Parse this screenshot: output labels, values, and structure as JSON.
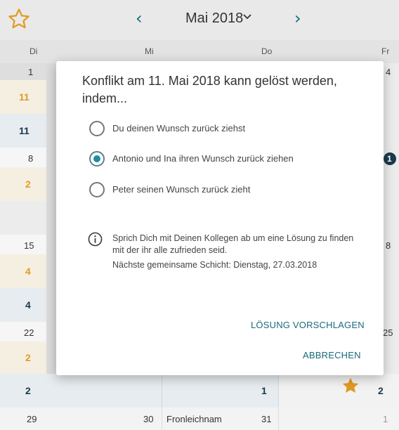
{
  "header": {
    "month": "Mai 2018",
    "prev_arrow": "‹",
    "next_arrow": "›"
  },
  "weekdays": [
    "Di",
    "Mi",
    "Do",
    "Fr"
  ],
  "calendar": {
    "week1": {
      "di_day": "1",
      "fr_day": "4",
      "count_a": "11",
      "count_b": "11"
    },
    "week2": {
      "di_day": "8",
      "count_a": "2",
      "fr_badge": "1"
    },
    "week3": {
      "di_day": "15",
      "fr_day": "8",
      "count_a": "4",
      "count_b": "4"
    },
    "week4": {
      "di_day": "22",
      "fr_day": "25",
      "count_a": "2",
      "count_b": "2",
      "do_count": "1",
      "fr_count": "2"
    },
    "week5": {
      "di_day": "29",
      "mi_day": "30",
      "do_label": "Fronleichnam",
      "do_day": "31",
      "fr_day": "1"
    }
  },
  "dialog": {
    "title": "Konflikt am 11. Mai 2018 kann gelöst werden, indem...",
    "options": [
      {
        "label": "Du deinen Wunsch zurück ziehst",
        "selected": false
      },
      {
        "label": "Antonio und Ina ihren Wunsch zurück ziehen",
        "selected": true
      },
      {
        "label": "Peter seinen Wunsch zurück zieht",
        "selected": false
      }
    ],
    "info_text": "Sprich Dich mit Deinen Kollegen ab um eine Lösung zu finden mit der ihr alle zufrieden seid.",
    "next_shift": "Nächste gemeinsame Schicht: Dienstag, 27.03.2018",
    "propose_button": "LÖSUNG VORSCHLAGEN",
    "cancel_button": "ABBRECHEN"
  },
  "colors": {
    "accent": "#1a6b78",
    "radio_selected": "#1d8ea0",
    "star": "#e29a22",
    "count_orange": "#e29a22",
    "count_navy": "#1b3a4b"
  },
  "icons": {
    "favorite": "star-outline-icon",
    "filled_star": "star-icon",
    "info": "info-icon",
    "dropdown": "chevron-down-icon"
  }
}
